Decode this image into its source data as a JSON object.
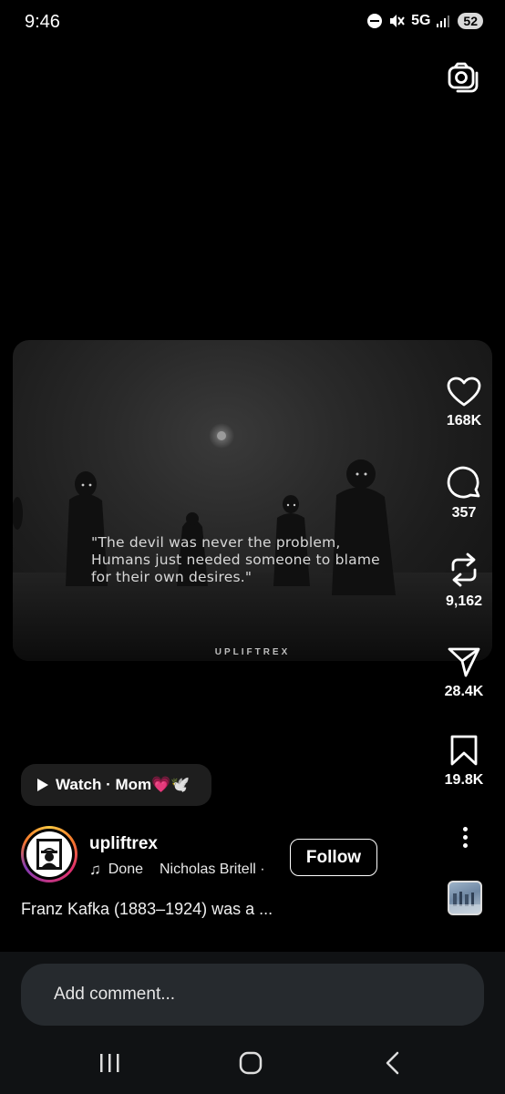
{
  "status_bar": {
    "time": "9:46",
    "network": "5G",
    "battery": "52"
  },
  "post": {
    "quote_lines": [
      "\"The devil was never the problem,",
      "Humans just needed someone to blame",
      "for their own desires.\""
    ],
    "watermark": "UPLIFTREX"
  },
  "actions": {
    "likes": "168K",
    "comments": "357",
    "reposts": "9,162",
    "shares": "28.4K",
    "saves": "19.8K"
  },
  "watch_chip": {
    "label": "Watch · Mom💗🕊️"
  },
  "author": {
    "username": "upliftrex",
    "follow_label": "Follow",
    "music_left": "Done",
    "music_right": "Nicholas Britell ·"
  },
  "caption": "Franz Kafka (1883–1924) was a ...",
  "comment": {
    "placeholder": "Add comment..."
  },
  "colors": {
    "background": "#000000",
    "chip": "#1e1e1e",
    "comment_bar": "#262a2e"
  }
}
